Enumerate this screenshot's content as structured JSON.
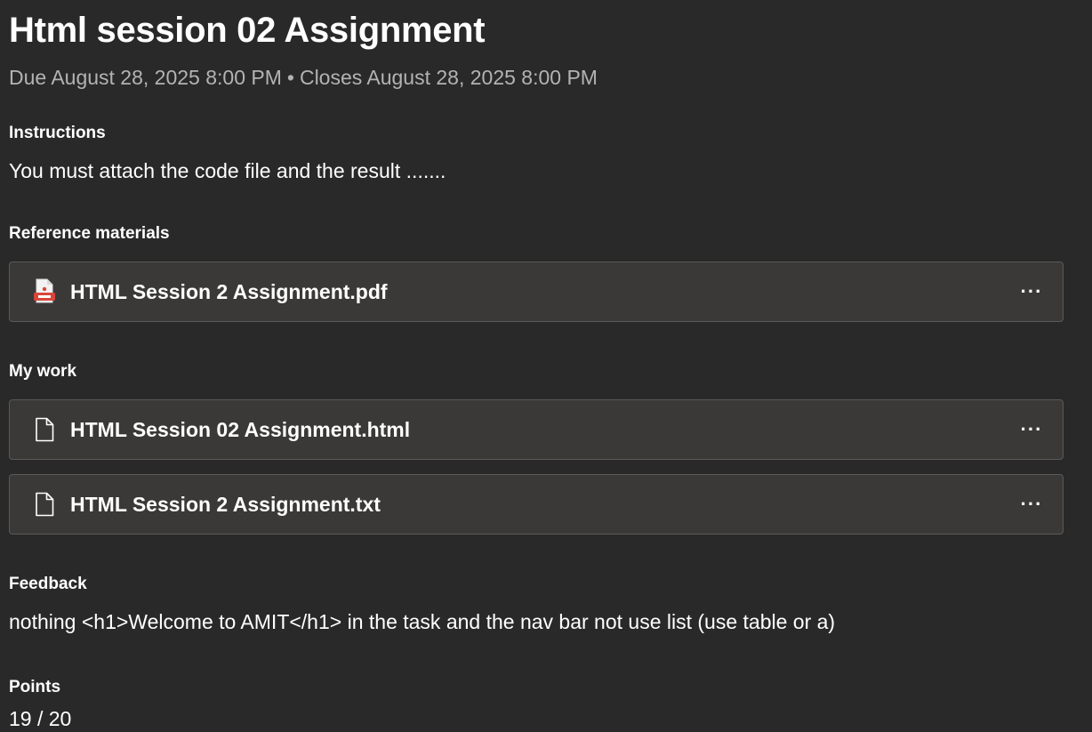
{
  "assignment": {
    "title": "Html session 02 Assignment",
    "due": "Due August 28, 2025 8:00 PM",
    "separator": "•",
    "closes": "Closes August 28, 2025 8:00 PM"
  },
  "instructions": {
    "label": "Instructions",
    "text": "You must attach the code file and the result ......."
  },
  "reference_materials": {
    "label": "Reference materials",
    "files": [
      {
        "name": "HTML Session 2 Assignment.pdf",
        "icon": "pdf-icon"
      }
    ]
  },
  "my_work": {
    "label": "My work",
    "files": [
      {
        "name": "HTML Session 02 Assignment.html",
        "icon": "file-icon"
      },
      {
        "name": "HTML Session 2 Assignment.txt",
        "icon": "file-icon"
      }
    ]
  },
  "feedback": {
    "label": "Feedback",
    "text": "nothing <h1>Welcome to AMIT</h1> in the task and the nav bar not use list (use table or a)"
  },
  "points": {
    "label": "Points",
    "value": "19 / 20"
  },
  "more_button_glyph": "···",
  "colors": {
    "background": "#292929",
    "card": "#3a3938",
    "card_border": "#5a5958",
    "muted_text": "#b3b3b3",
    "pdf_red": "#d9453b"
  }
}
